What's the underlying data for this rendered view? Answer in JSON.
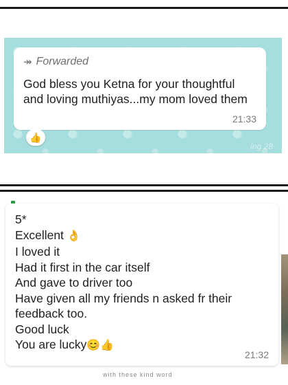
{
  "screenshot_top": {
    "forwarded_label": "Forwarded",
    "message": "God bless you Ketna for your thoughtful and loving muthiyas...my mom loved them",
    "time": "21:33",
    "reaction": "👍",
    "watermark": "ing 28"
  },
  "screenshot_bottom": {
    "lines": [
      "5*",
      "Excellent",
      "I loved it",
      "Had it first in the car itself",
      "And gave to driver too",
      "Have given all my friends n asked fr their",
      "feedback too.",
      "Good luck",
      "You are lucky"
    ],
    "excellent_emoji": "👌",
    "lucky_emojis": "😊👍",
    "time": "21:32",
    "cut_text": "with these kind word"
  }
}
